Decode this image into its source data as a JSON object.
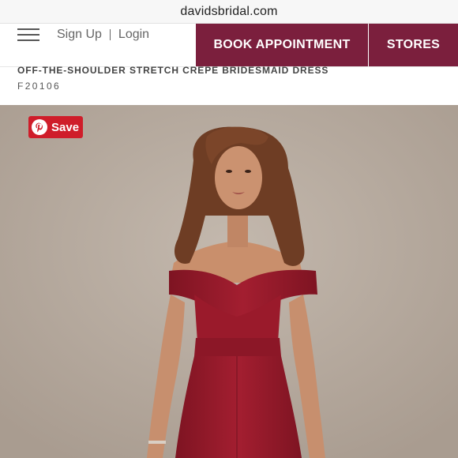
{
  "browser": {
    "url": "davidsbridal.com"
  },
  "header": {
    "sign_up": "Sign Up",
    "login": "Login",
    "book_appointment": "BOOK APPOINTMENT",
    "stores": "STORES"
  },
  "product": {
    "title": "OFF-THE-SHOULDER STRETCH CREPE BRIDESMAID DRESS",
    "sku": "F20106"
  },
  "image": {
    "save_label": "Save",
    "save_icon": "pinterest-icon"
  },
  "colors": {
    "brand": "#7b1f3d",
    "pinterest": "#cf1d2a",
    "backdrop": "#b6aa9f",
    "dress": "#9b1b2c"
  }
}
